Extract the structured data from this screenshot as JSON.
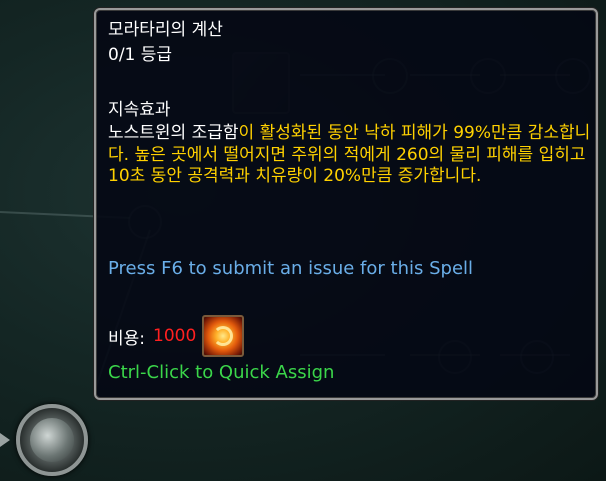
{
  "tooltip": {
    "title": "모라타리의 계산",
    "rank": "0/1 등급",
    "section_label": "지속효과",
    "description": {
      "highlight": "노스트윈의 조급함",
      "body": "이 활성화된 동안 낙하 피해가 99%만큼 감소합니다. 높은 곳에서 떨어지면 주위의 적에게 260의 물리 피해를 입히고 10초 동안 공격력과 치유량이 20%만큼 증가합니다."
    },
    "issue_hint": "Press F6 to submit an issue for this Spell",
    "cost": {
      "label": "비용:",
      "value": "1000",
      "currency_icon": "ember-orb-icon"
    },
    "assign_hint": "Ctrl-Click to Quick Assign"
  },
  "colors": {
    "title": "#ffffff",
    "highlight": "#ffffff",
    "description": "#ffd100",
    "issue_hint": "#6aaee8",
    "cost_value": "#ff2020",
    "assign_hint": "#3bd64a",
    "border": "#9a9a9a"
  },
  "background": {
    "talent_node_icon": "wolf-head-icon",
    "faded_spell_icon": "figure-silhouette-icon"
  }
}
